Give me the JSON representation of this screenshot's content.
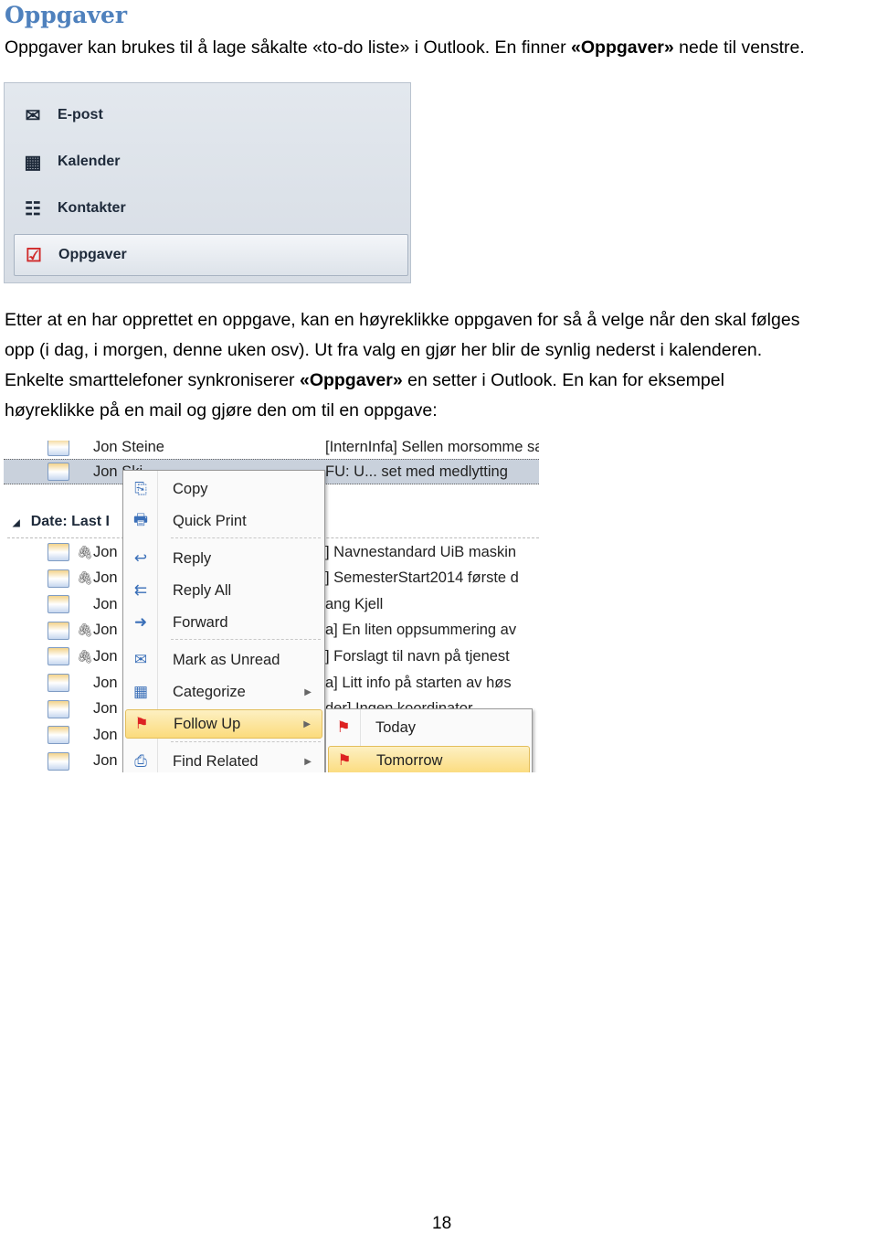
{
  "heading": "Oppgaver",
  "intro": {
    "pre": "Oppgaver kan brukes til å lage såkalte «to-do liste» i Outlook. En finner ",
    "bold": "«Oppgaver»",
    "post": " nede til venstre."
  },
  "nav_pane": {
    "items": [
      {
        "label": "E-post",
        "icon": "mail-icon"
      },
      {
        "label": "Kalender",
        "icon": "calendar-icon"
      },
      {
        "label": "Kontakter",
        "icon": "contacts-icon"
      },
      {
        "label": "Oppgaver",
        "icon": "tasks-icon",
        "selected": true
      }
    ]
  },
  "para2": {
    "line1": "Etter at en har opprettet en oppgave, kan en høyreklikke oppgaven for så å velge når den skal følges",
    "line2": "opp (i dag, i morgen, denne uken osv). Ut fra valg en gjør her blir de synlig nederst i kalenderen.",
    "line3_pre": "Enkelte smarttelefoner synkroniserer ",
    "line3_bold": "«Oppgaver»",
    "line3_post": " en setter i Outlook. En kan for eksempel",
    "line4": "høyreklikke på en mail og gjøre den om til en oppgave:"
  },
  "mail_list": {
    "top_rows": [
      {
        "from": "Jon Steine",
        "subject": "[InternInfa]  Sellen morsomme saker. s"
      },
      {
        "from": "Jon Ski",
        "subject": "FU: U... set med medlytting",
        "selected": true
      }
    ],
    "group_header": "Date: Last I",
    "rows": [
      {
        "from": "Jon",
        "subject": "]  Navnestandard UiB maskin",
        "attachment": true
      },
      {
        "from": "Jon",
        "subject": "]  SemesterStart2014 første d",
        "attachment": true
      },
      {
        "from": "Jon",
        "subject": "ang Kjell",
        "attachment": false
      },
      {
        "from": "Jon",
        "subject": "a]  En liten oppsummering av",
        "attachment": true
      },
      {
        "from": "Jon",
        "subject": "]  Forslagt til navn på tjenest",
        "attachment": true
      },
      {
        "from": "Jon",
        "subject": "a]  Litt info på starten av høs",
        "attachment": false
      },
      {
        "from": "Jon",
        "subject": "der]  Ingen koordinator...",
        "attachment": false
      },
      {
        "from": "Jon",
        "subject": "",
        "attachment": false
      },
      {
        "from": "Jon",
        "subject": "",
        "attachment": false
      }
    ]
  },
  "context_menu": {
    "items": [
      {
        "label": "Copy",
        "icon": "copy-icon"
      },
      {
        "label": "Quick Print",
        "icon": "printer-icon"
      },
      {
        "label": "Reply",
        "icon": "reply-icon"
      },
      {
        "label": "Reply All",
        "icon": "reply-all-icon"
      },
      {
        "label": "Forward",
        "icon": "forward-icon"
      },
      {
        "label": "Mark as Unread",
        "icon": "mark-unread-icon"
      },
      {
        "label": "Categorize",
        "icon": "categorize-icon",
        "submenu": true
      },
      {
        "label": "Follow Up",
        "icon": "flag-icon",
        "submenu": true,
        "highlighted": true
      },
      {
        "label": "Find Related",
        "icon": "find-related-icon",
        "submenu": true
      }
    ]
  },
  "submenu": {
    "items": [
      {
        "label": "Today",
        "icon": "flag-icon"
      },
      {
        "label": "Tomorrow",
        "icon": "flag-icon",
        "highlighted": true
      }
    ]
  },
  "page_number": "18",
  "colors": {
    "heading": "#4f81bd",
    "menu_highlight": "#fbdb7c",
    "selection": "#c9d1dc"
  }
}
